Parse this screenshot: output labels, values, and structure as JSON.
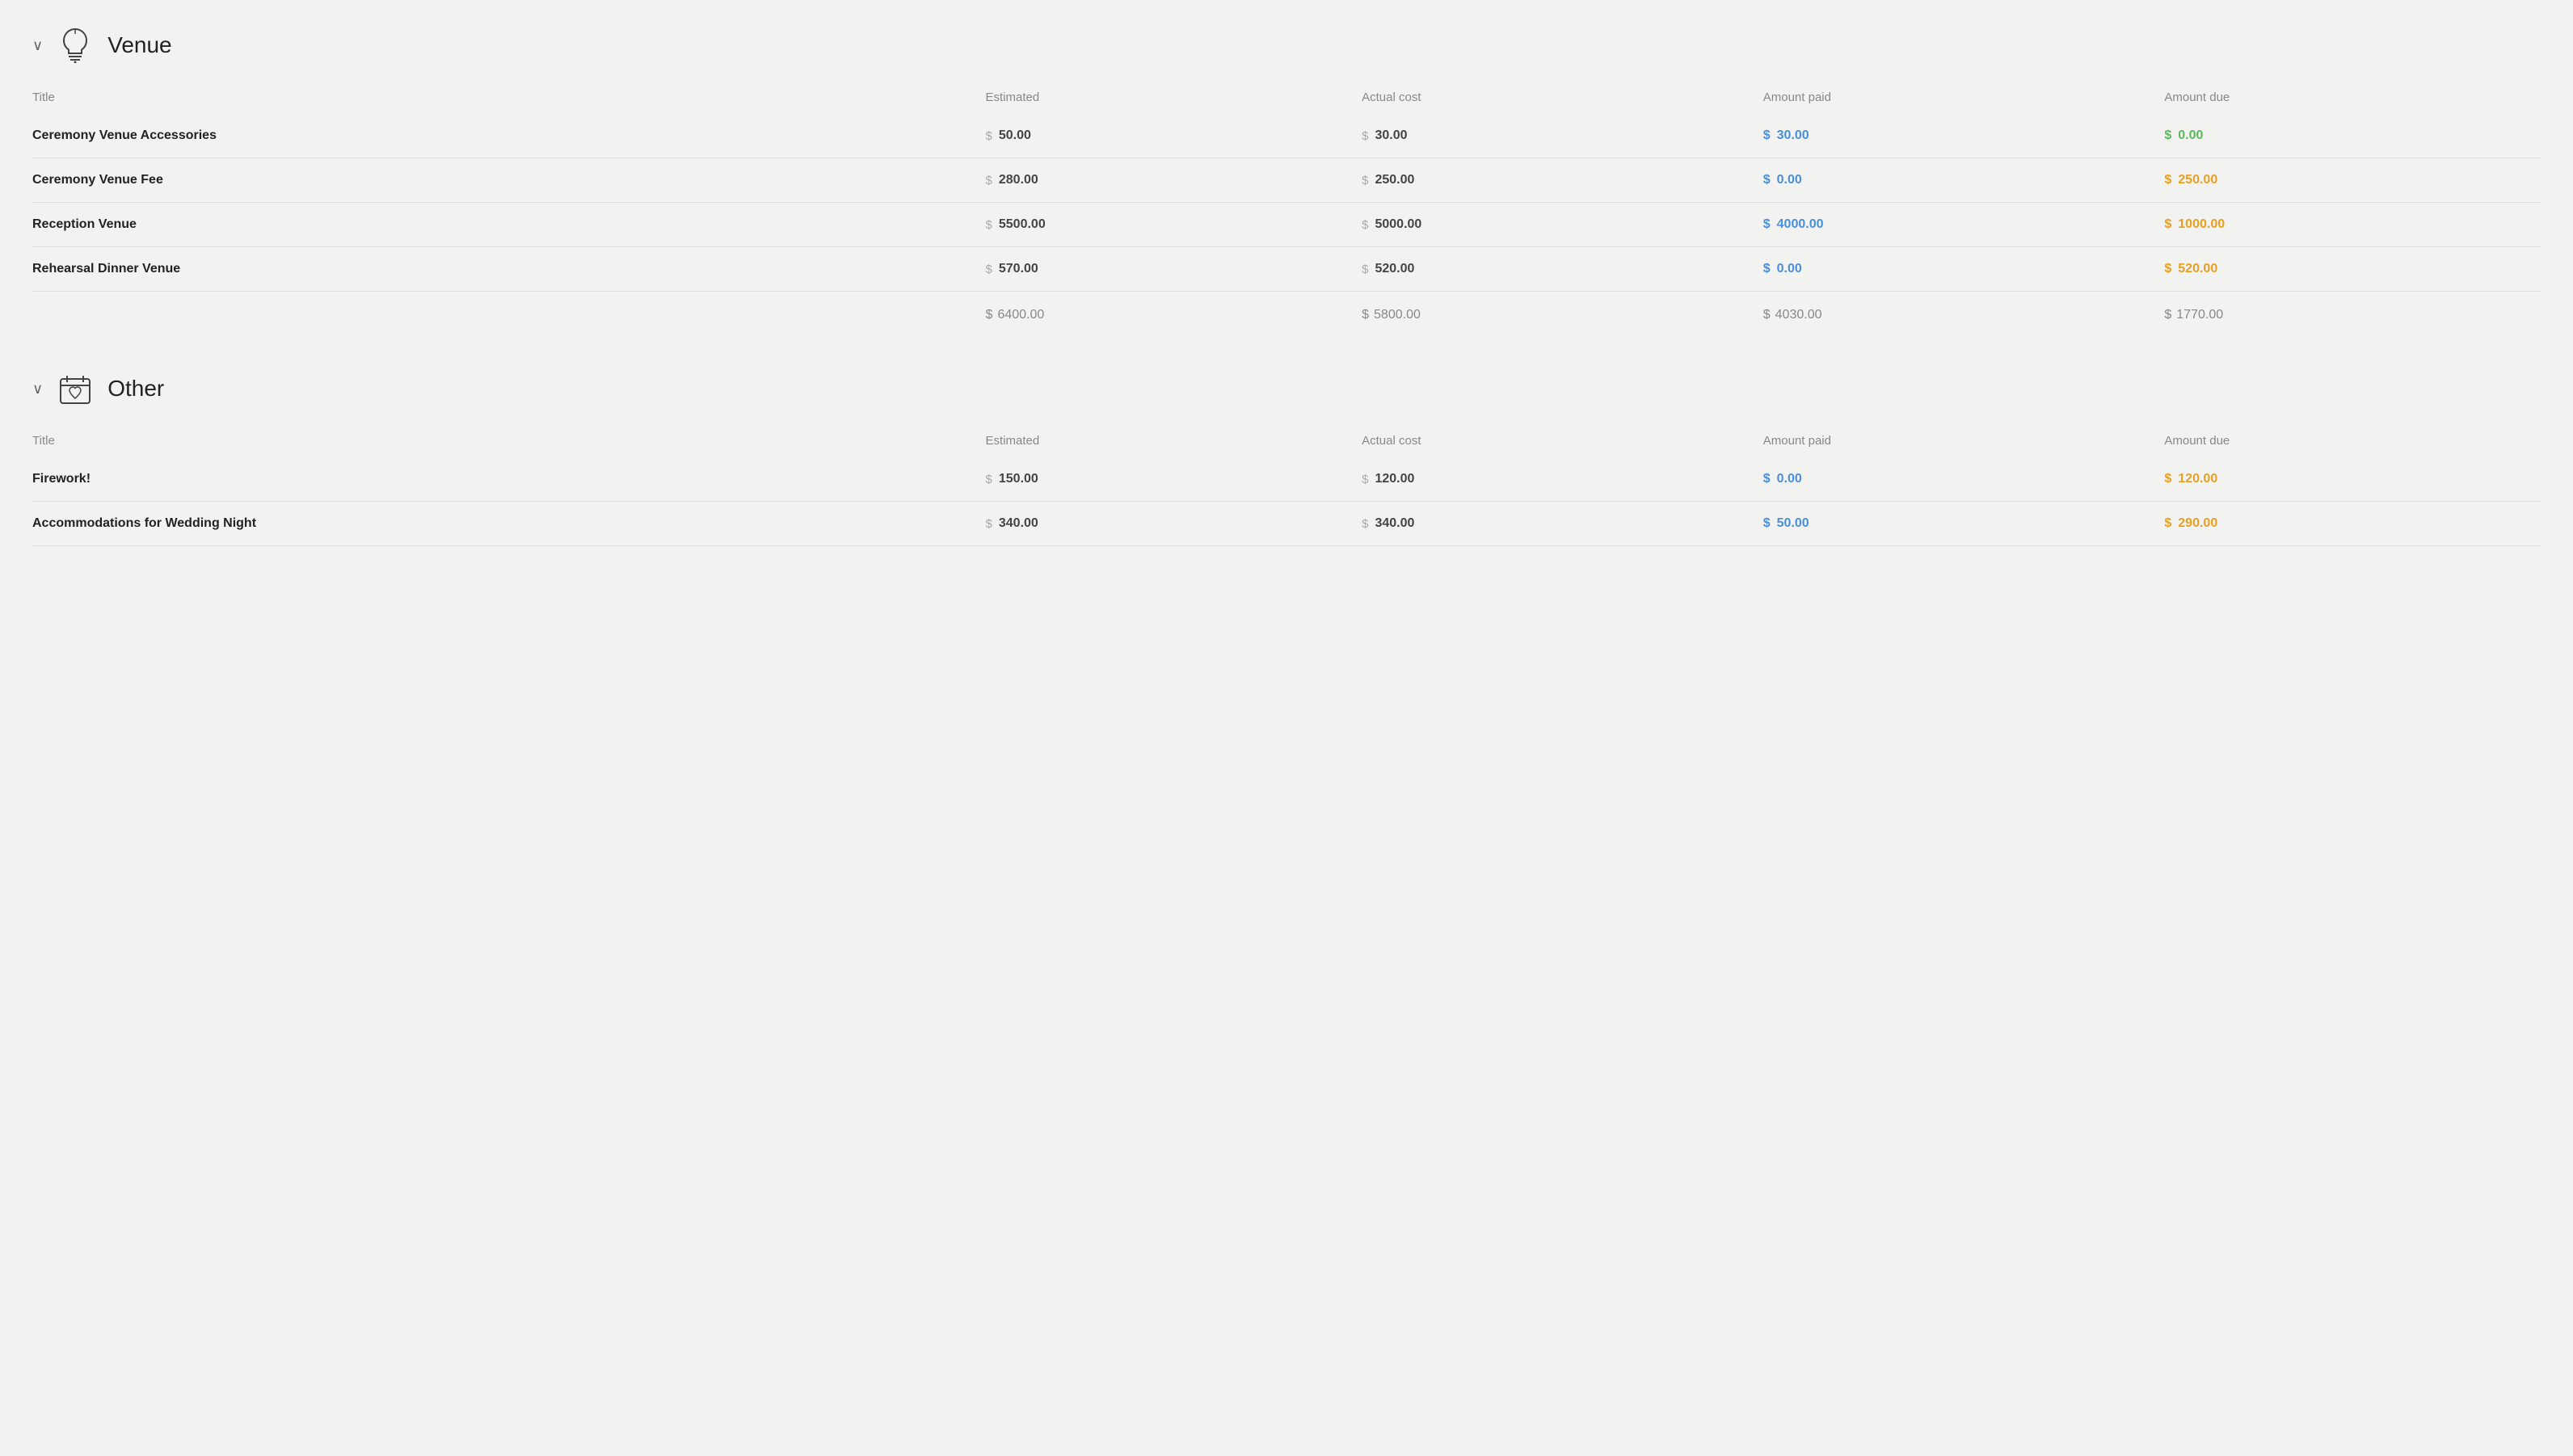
{
  "sections": [
    {
      "id": "venue",
      "title": "Venue",
      "icon": "lightbulb",
      "headers": [
        "Title",
        "Estimated",
        "Actual cost",
        "Amount paid",
        "Amount due"
      ],
      "rows": [
        {
          "title": "Ceremony Venue Accessories",
          "estimated": "50.00",
          "actual": "30.00",
          "paid": "30.00",
          "due": "0.00",
          "paid_zero": false,
          "due_zero": true
        },
        {
          "title": "Ceremony Venue Fee",
          "estimated": "280.00",
          "actual": "250.00",
          "paid": "0.00",
          "due": "250.00",
          "paid_zero": true,
          "due_zero": false
        },
        {
          "title": "Reception Venue",
          "estimated": "5500.00",
          "actual": "5000.00",
          "paid": "4000.00",
          "due": "1000.00",
          "paid_zero": false,
          "due_zero": false
        },
        {
          "title": "Rehearsal Dinner Venue",
          "estimated": "570.00",
          "actual": "520.00",
          "paid": "0.00",
          "due": "520.00",
          "paid_zero": true,
          "due_zero": false
        }
      ],
      "totals": {
        "estimated": "6400.00",
        "actual": "5800.00",
        "paid": "4030.00",
        "due": "1770.00"
      }
    },
    {
      "id": "other",
      "title": "Other",
      "icon": "heart",
      "headers": [
        "Title",
        "Estimated",
        "Actual cost",
        "Amount paid",
        "Amount due"
      ],
      "rows": [
        {
          "title": "Firework!",
          "estimated": "150.00",
          "actual": "120.00",
          "paid": "0.00",
          "due": "120.00",
          "paid_zero": true,
          "due_zero": false
        },
        {
          "title": "Accommodations for Wedding Night",
          "estimated": "340.00",
          "actual": "340.00",
          "paid": "50.00",
          "due": "290.00",
          "paid_zero": false,
          "due_zero": false
        }
      ],
      "totals": null
    }
  ],
  "labels": {
    "chevron": "∨",
    "dollar": "$"
  }
}
